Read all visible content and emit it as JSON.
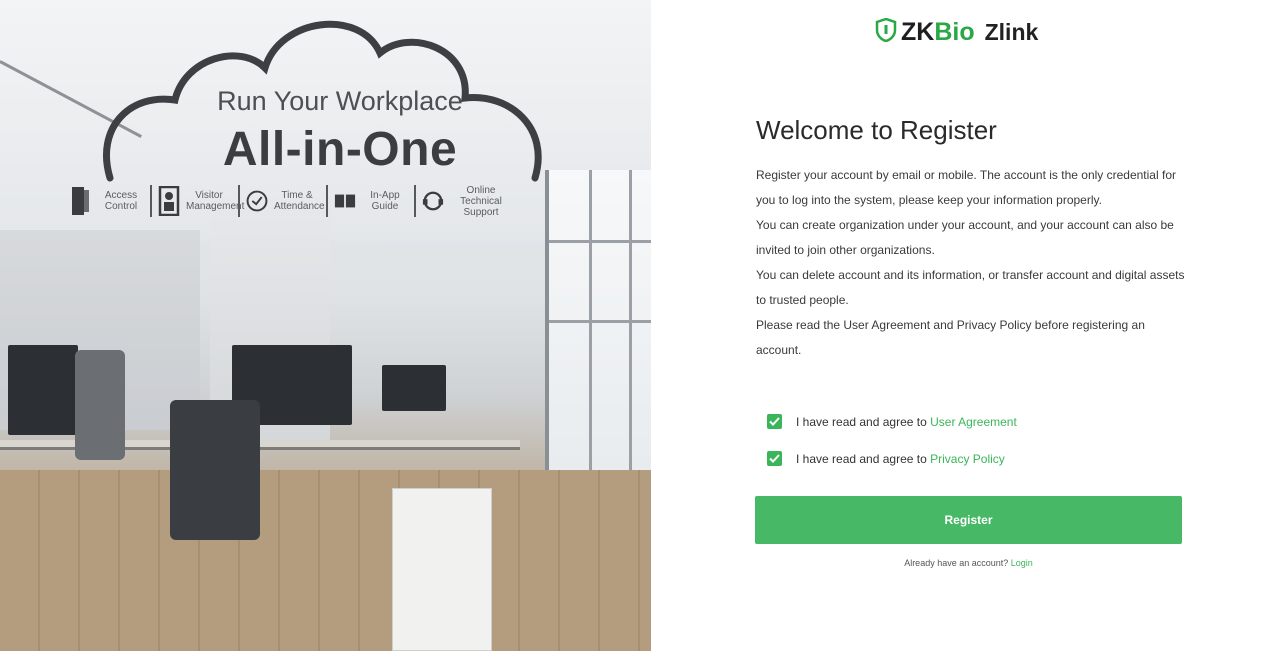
{
  "hero": {
    "tagline": "Run Your Workplace",
    "title": "All-in-One",
    "features": [
      {
        "icon": "door-icon",
        "label": "Access Control"
      },
      {
        "icon": "visitor-icon",
        "label": "Visitor Management"
      },
      {
        "icon": "clock-icon",
        "label": "Time & Attendance"
      },
      {
        "icon": "book-icon",
        "label": "In-App Guide"
      },
      {
        "icon": "support-icon",
        "label": "Online Technical Support"
      }
    ]
  },
  "brand": {
    "logo_prefix": "ZK",
    "logo_bio": "Bio",
    "logo_suffix": "Zlink",
    "accent_color": "#3bb55a"
  },
  "register": {
    "title": "Welcome to Register",
    "paragraphs": [
      "Register your account by email or mobile. The account is the only credential for you to log into the system, please keep your information properly.",
      "You can create organization under your account, and your account can also be invited to join other organizations.",
      "You can delete account and its information, or transfer account and digital assets to trusted people.",
      "Please read the User Agreement and Privacy Policy before registering an account."
    ],
    "agree_prefix": "I have read and agree to",
    "user_agreement_link": "User Agreement",
    "privacy_policy_link": "Privacy Policy",
    "user_agreement_checked": true,
    "privacy_policy_checked": true,
    "register_button": "Register",
    "already_have_account": "Already have an account?",
    "login_link": "Login"
  }
}
